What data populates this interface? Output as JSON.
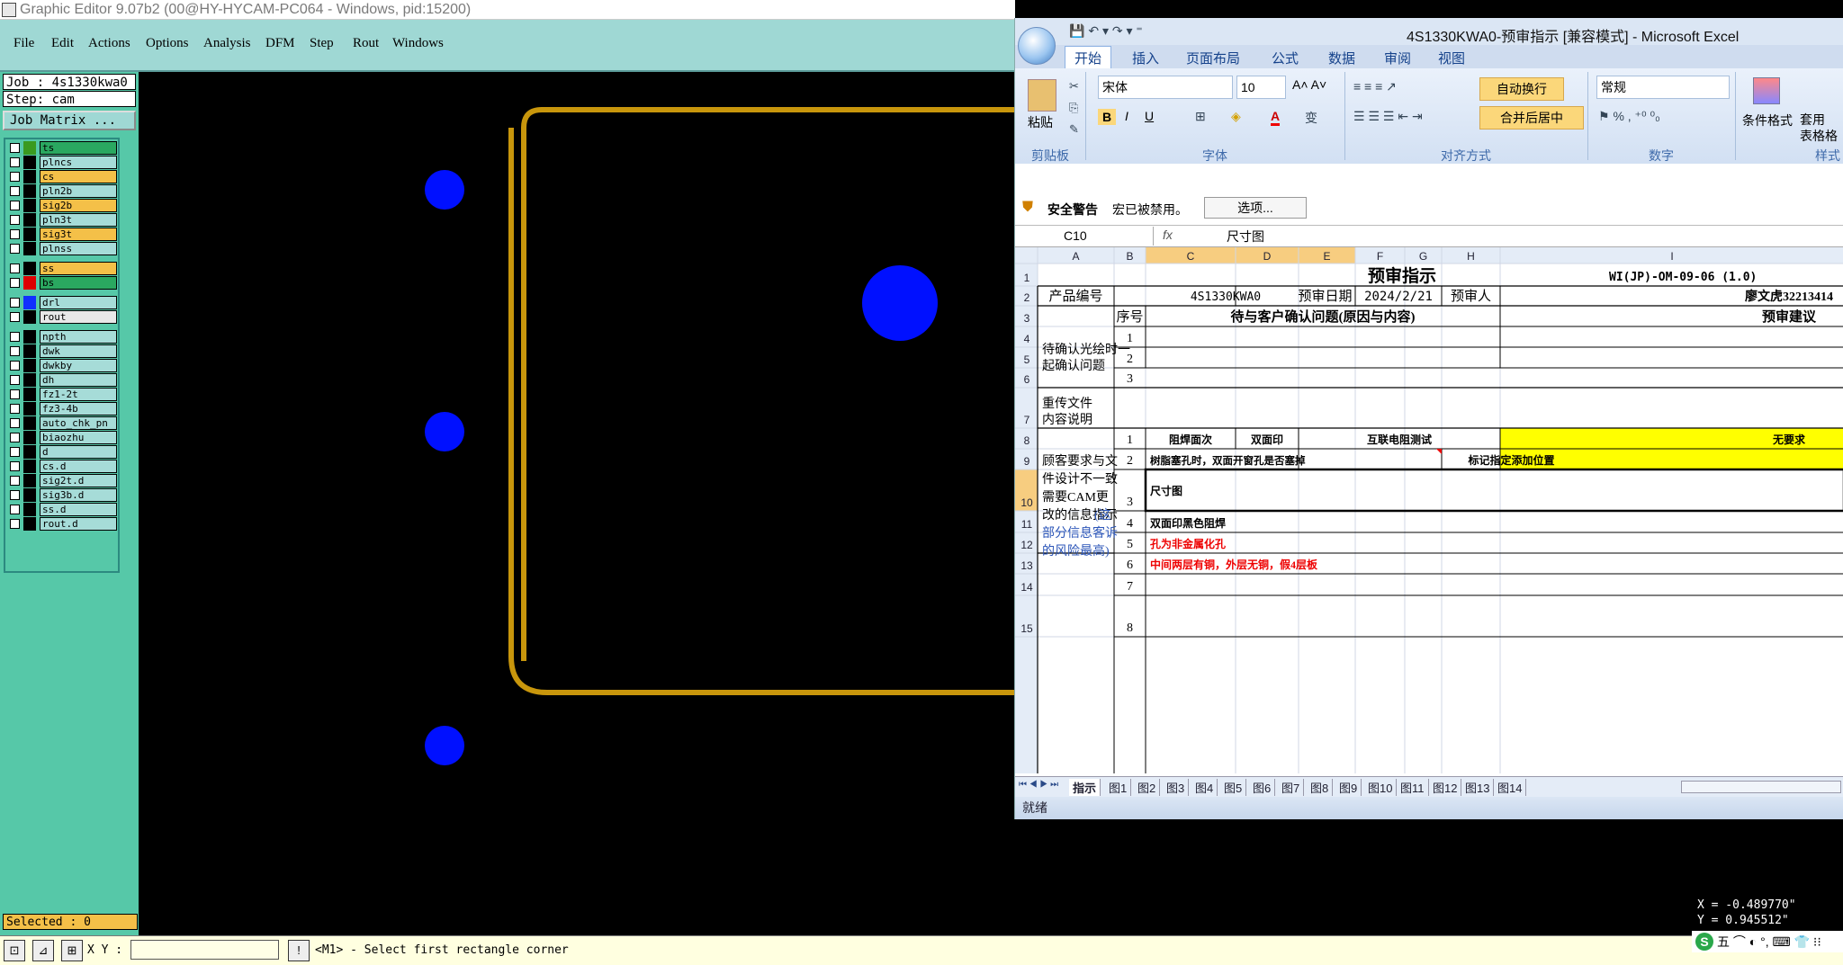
{
  "editor": {
    "title": "Graphic Editor 9.07b2 (00@HY-HYCAM-PC064 - Windows, pid:15200)",
    "menu": [
      "File",
      "Edit",
      "Actions",
      "Options",
      "Analysis",
      "DFM",
      "Step",
      "Rout",
      "Windows"
    ],
    "job": "Job : 4s1330kwa0",
    "step": "Step: cam",
    "job_matrix": "Job Matrix ...",
    "layers": [
      {
        "name": "ts",
        "swatch": "#3a9a20",
        "color": "#2aa860"
      },
      {
        "name": "plncs",
        "swatch": "#000000",
        "color": "#a6dcd8"
      },
      {
        "name": "cs",
        "swatch": "#000000",
        "color": "#f4c048"
      },
      {
        "name": "pln2b",
        "swatch": "#000000",
        "color": "#a6dcd8"
      },
      {
        "name": "sig2b",
        "swatch": "#000000",
        "color": "#f4c048"
      },
      {
        "name": "pln3t",
        "swatch": "#000000",
        "color": "#a6dcd8"
      },
      {
        "name": "sig3t",
        "swatch": "#000000",
        "color": "#f4c048"
      },
      {
        "name": "plnss",
        "swatch": "#000000",
        "color": "#a6dcd8"
      },
      {
        "name": "ss",
        "swatch": "#000000",
        "color": "#f4c048"
      },
      {
        "name": "bs",
        "swatch": "#dd0000",
        "color": "#2aa860"
      },
      {
        "name": "drl",
        "swatch": "#1030ff",
        "color": "#a6dcd8"
      },
      {
        "name": "rout",
        "swatch": "#000000",
        "color": "#e8e8e8"
      },
      {
        "name": "npth",
        "swatch": "#000000",
        "color": "#a6dcd8"
      },
      {
        "name": "dwk",
        "swatch": "#000000",
        "color": "#a6dcd8"
      },
      {
        "name": "dwkby",
        "swatch": "#000000",
        "color": "#a6dcd8"
      },
      {
        "name": "dh",
        "swatch": "#000000",
        "color": "#a6dcd8"
      },
      {
        "name": "fz1-2t",
        "swatch": "#000000",
        "color": "#a6dcd8"
      },
      {
        "name": "fz3-4b",
        "swatch": "#000000",
        "color": "#a6dcd8"
      },
      {
        "name": "auto_chk_pn",
        "swatch": "#000000",
        "color": "#a6dcd8"
      },
      {
        "name": "biaozhu",
        "swatch": "#000000",
        "color": "#a6dcd8"
      },
      {
        "name": "d",
        "swatch": "#000000",
        "color": "#a6dcd8"
      },
      {
        "name": "cs.d",
        "swatch": "#000000",
        "color": "#a6dcd8"
      },
      {
        "name": "sig2t.d",
        "swatch": "#000000",
        "color": "#a6dcd8"
      },
      {
        "name": "sig3b.d",
        "swatch": "#000000",
        "color": "#a6dcd8"
      },
      {
        "name": "ss.d",
        "swatch": "#000000",
        "color": "#a6dcd8"
      },
      {
        "name": "rout.d",
        "swatch": "#000000",
        "color": "#a6dcd8"
      }
    ],
    "selected": "Selected : 0",
    "xy_label": "X Y :",
    "message": "<M1> - Select first rectangle corner",
    "coord_x": "X = -0.489770\"",
    "coord_y": "Y = 0.945512\"",
    "tray": "五 ⌒ ◐ °, ⌨ 👕 ⁝⁝",
    "board_color": "#c8960c",
    "pad_color": "#0010ff"
  },
  "excel": {
    "title": "4S1330KWA0-预审指示 [兼容模式] - Microsoft Excel",
    "tabs": [
      "开始",
      "插入",
      "页面布局",
      "公式",
      "数据",
      "审阅",
      "视图"
    ],
    "groups": [
      "剪贴板",
      "字体",
      "对齐方式",
      "数字",
      "样式"
    ],
    "paste": "粘贴",
    "font": "宋体",
    "size": "10",
    "wrap": "自动换行",
    "merge": "合并后居中",
    "numfmt": "常规",
    "cond": "条件格式",
    "tablefmt": "套用\n表格格",
    "security_label": "安全警告",
    "security_text": "宏已被禁用。",
    "options_btn": "选项...",
    "namebox": "C10",
    "fx": "fx",
    "formula": "尺寸图",
    "columns": [
      "A",
      "B",
      "C",
      "D",
      "E",
      "F",
      "G",
      "H",
      "I"
    ],
    "rows": [
      "1",
      "2",
      "3",
      "4",
      "5",
      "6",
      "7",
      "8",
      "9",
      "10",
      "11",
      "12",
      "13",
      "14",
      "15"
    ],
    "cells": {
      "title": "预审指示",
      "doc_no": "WI(JP)-OM-09-06 (1.0)",
      "prod_label": "产品编号",
      "prod_value": "4S1330KWA0",
      "date_label": "预审日期",
      "date_value": "2024/2/21",
      "person_label": "预审人",
      "person_value": "廖文虎32213414",
      "seq": "序号",
      "issue_header": "待与客户确认问题(原因与内容)",
      "advice_header": "预审建议",
      "pending": "待确认光绘时一起确认问题",
      "n1": "1",
      "n2": "2",
      "n3": "3",
      "resend": "重传文件\n内容说明",
      "m1": "1",
      "m2": "2",
      "m3": "3",
      "m4": "4",
      "m5": "5",
      "m6": "6",
      "m7": "7",
      "m8": "8",
      "r8c": "阻焊面次",
      "r8d": "双面印",
      "r8e": "互联电阻测试",
      "r8i": "无要求",
      "r9c": "树脂塞孔时，双面开窗孔是否塞掉",
      "r9h": "标记指定添加位置",
      "r10": "尺寸图",
      "r11": "双面印黑色阻焊",
      "r12": "孔为非金属化孔",
      "r13": "中间两层有铜，外层无铜，假4层板",
      "cust_a": "顾客要求与文件设计不一致需要CAM更改的信息指示",
      "cust_b": "(这部分信息客诉的风险最高)"
    },
    "sheets": [
      "指示",
      "图1",
      "图2",
      "图3",
      "图4",
      "图5",
      "图6",
      "图7",
      "图8",
      "图9",
      "图10",
      "图11",
      "图12",
      "图13",
      "图14"
    ],
    "status": "就绪"
  }
}
